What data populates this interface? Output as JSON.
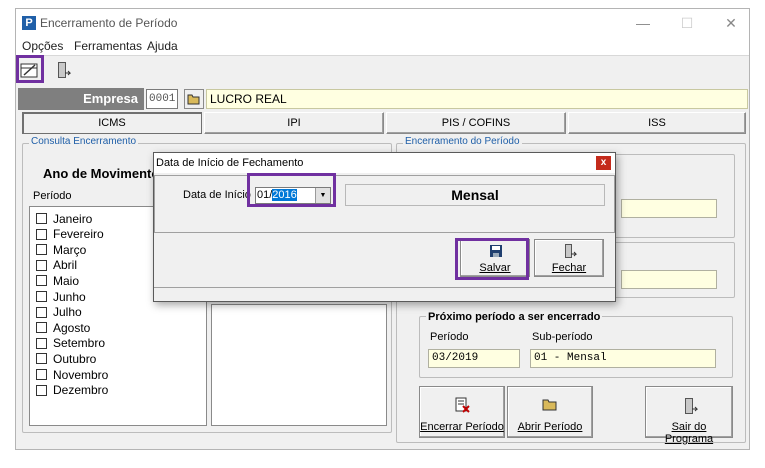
{
  "window": {
    "title": "Encerramento de Período",
    "app_icon": "P"
  },
  "menu": [
    {
      "label": "Opções"
    },
    {
      "label": "Ferramentas"
    },
    {
      "label": "Ajuda"
    }
  ],
  "toolbar": {
    "icons": [
      "calendar-edit-icon",
      "exit-door-icon"
    ]
  },
  "empresa": {
    "label": "Empresa",
    "code": "0001",
    "name": "LUCRO REAL"
  },
  "tabs": [
    {
      "label": "ICMS",
      "active": true
    },
    {
      "label": "IPI",
      "active": false
    },
    {
      "label": "PIS / COFINS",
      "active": false
    },
    {
      "label": "ISS",
      "active": false
    }
  ],
  "consulta": {
    "title": "Consulta Encerramento",
    "ano_label": "Ano de Movimento",
    "periodo_header": "Período",
    "months": [
      "Janeiro",
      "Fevereiro",
      "Março",
      "Abril",
      "Maio",
      "Junho",
      "Julho",
      "Agosto",
      "Setembro",
      "Outubro",
      "Novembro",
      "Dezembro"
    ]
  },
  "encerramento": {
    "title": "Encerramento do Período",
    "proximo_title": "Próximo período a ser encerrado",
    "periodo_label": "Período",
    "subperiodo_label": "Sub-período",
    "periodo_value": "03/2019",
    "subperiodo_value": "01 - Mensal",
    "buttons": [
      {
        "label": "Encerrar Período",
        "icon": "close-period-icon"
      },
      {
        "label": "Abrir Período",
        "icon": "open-folder-icon"
      },
      {
        "label": "Sair do Programa",
        "icon": "exit-door-icon"
      }
    ]
  },
  "dialog": {
    "title": "Data de Início de Fechamento",
    "close_label": "x",
    "date_label": "Data de Início",
    "date_month": "01/",
    "date_year": "2016",
    "mode": "Mensal",
    "save_label": "Salvar",
    "close_btn_label": "Fechar"
  },
  "colors": {
    "highlight": "#7030a0",
    "field_bg": "#ffffe1",
    "group_title": "#1f5fa8",
    "selection": "#0078d7"
  }
}
